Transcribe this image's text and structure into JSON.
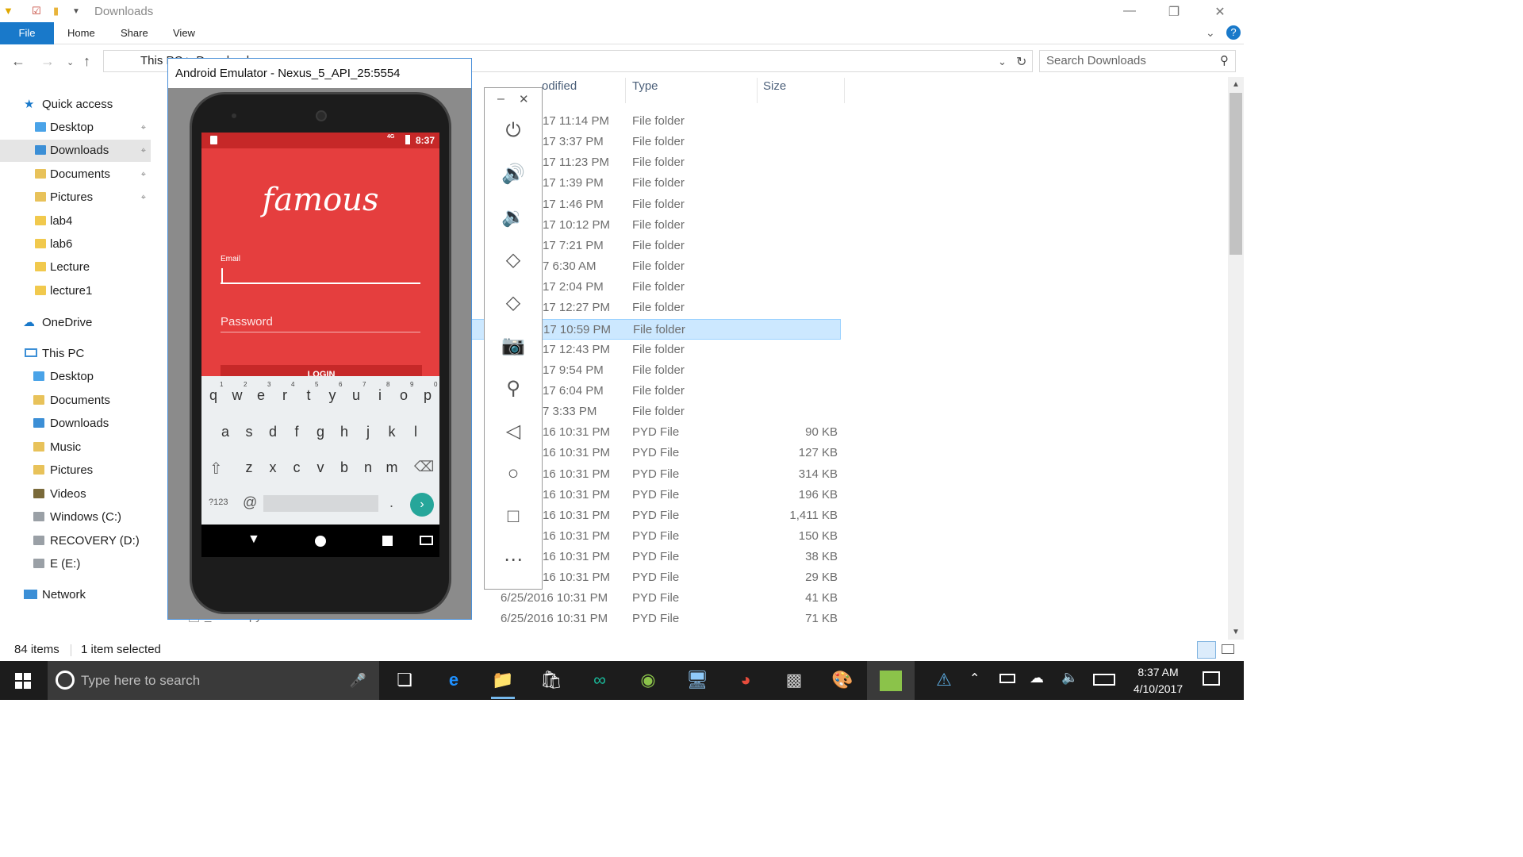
{
  "window": {
    "title": "Downloads",
    "tabs": [
      "File",
      "Home",
      "Share",
      "View"
    ]
  },
  "address": {
    "path": "This PC > Downloads",
    "search_placeholder": "Search Downloads"
  },
  "nav": {
    "quick_access": "Quick access",
    "quick_items": [
      {
        "label": "Desktop",
        "pinned": true,
        "icon": "folder-blue-icon"
      },
      {
        "label": "Downloads",
        "pinned": true,
        "icon": "downloads-icon",
        "selected": true
      },
      {
        "label": "Documents",
        "pinned": true,
        "icon": "documents-icon"
      },
      {
        "label": "Pictures",
        "pinned": true,
        "icon": "pictures-icon"
      },
      {
        "label": "lab4",
        "pinned": false,
        "icon": "folder-icon"
      },
      {
        "label": "lab6",
        "pinned": false,
        "icon": "folder-icon"
      },
      {
        "label": "Lecture",
        "pinned": false,
        "icon": "folder-icon"
      },
      {
        "label": "lecture1",
        "pinned": false,
        "icon": "folder-icon"
      }
    ],
    "onedrive": "OneDrive",
    "this_pc": "This PC",
    "pc_items": [
      {
        "label": "Desktop",
        "icon": "folder-blue-icon"
      },
      {
        "label": "Documents",
        "icon": "documents-icon"
      },
      {
        "label": "Downloads",
        "icon": "downloads-icon"
      },
      {
        "label": "Music",
        "icon": "music-icon"
      },
      {
        "label": "Pictures",
        "icon": "pictures-icon"
      },
      {
        "label": "Videos",
        "icon": "videos-icon"
      },
      {
        "label": "Windows (C:)",
        "icon": "drive-icon"
      },
      {
        "label": "RECOVERY (D:)",
        "icon": "drive-icon"
      },
      {
        "label": "E (E:)",
        "icon": "drive-icon"
      }
    ],
    "network": "Network"
  },
  "columns": {
    "modified": "odified",
    "type": "Type",
    "size": "Size"
  },
  "rows": [
    {
      "date": "17 11:14 PM",
      "type": "File folder",
      "size": ""
    },
    {
      "date": "17 3:37 PM",
      "type": "File folder",
      "size": ""
    },
    {
      "date": "17 11:23 PM",
      "type": "File folder",
      "size": ""
    },
    {
      "date": "17 1:39 PM",
      "type": "File folder",
      "size": ""
    },
    {
      "date": "17 1:46 PM",
      "type": "File folder",
      "size": ""
    },
    {
      "date": "17 10:12 PM",
      "type": "File folder",
      "size": ""
    },
    {
      "date": "17 7:21 PM",
      "type": "File folder",
      "size": ""
    },
    {
      "date": "7 6:30 AM",
      "type": "File folder",
      "size": ""
    },
    {
      "date": "17 2:04 PM",
      "type": "File folder",
      "size": ""
    },
    {
      "date": "17 12:27 PM",
      "type": "File folder",
      "size": ""
    },
    {
      "date": "17 10:59 PM",
      "type": "File folder",
      "size": "",
      "selected": true
    },
    {
      "date": "17 12:43 PM",
      "type": "File folder",
      "size": ""
    },
    {
      "date": "17 9:54 PM",
      "type": "File folder",
      "size": ""
    },
    {
      "date": "17 6:04 PM",
      "type": "File folder",
      "size": ""
    },
    {
      "date": "7 3:33 PM",
      "type": "File folder",
      "size": ""
    },
    {
      "date": "16 10:31 PM",
      "type": "PYD File",
      "size": "90 KB"
    },
    {
      "date": "16 10:31 PM",
      "type": "PYD File",
      "size": "127 KB"
    },
    {
      "date": "16 10:31 PM",
      "type": "PYD File",
      "size": "314 KB"
    },
    {
      "date": "16 10:31 PM",
      "type": "PYD File",
      "size": "196 KB"
    },
    {
      "date": "16 10:31 PM",
      "type": "PYD File",
      "size": "1,411 KB"
    },
    {
      "date": "16 10:31 PM",
      "type": "PYD File",
      "size": "150 KB"
    },
    {
      "date": "16 10:31 PM",
      "type": "PYD File",
      "size": "38 KB"
    },
    {
      "date": "16 10:31 PM",
      "type": "PYD File",
      "size": "29 KB"
    }
  ],
  "full_rows": [
    {
      "date": "6/25/2016 10:31 PM",
      "type": "PYD File",
      "size": "41 KB"
    },
    {
      "date": "6/25/2016 10:31 PM",
      "type": "PYD File",
      "size": "71 KB"
    }
  ],
  "partial_filename": "_socket.pyd",
  "status": {
    "items": "84 items",
    "selected": "1 item selected"
  },
  "emulator": {
    "title": "Android Emulator - Nexus_5_API_25:5554",
    "time": "8:37",
    "network": "4G",
    "logo": "famous",
    "email_label": "Email",
    "password_label": "Password",
    "login_label": "LOGIN",
    "key_row1": [
      "q",
      "w",
      "e",
      "r",
      "t",
      "y",
      "u",
      "i",
      "o",
      "p"
    ],
    "key_row1_nums": [
      "1",
      "2",
      "3",
      "4",
      "5",
      "6",
      "7",
      "8",
      "9",
      "0"
    ],
    "key_row2": [
      "a",
      "s",
      "d",
      "f",
      "g",
      "h",
      "j",
      "k",
      "l"
    ],
    "key_row3": [
      "z",
      "x",
      "c",
      "v",
      "b",
      "n",
      "m"
    ],
    "sym_key": "?123",
    "at_key": "@",
    "dot_key": "."
  },
  "toolbar": {
    "items": [
      "power-icon",
      "volume-up-icon",
      "volume-down-icon",
      "rotate-left-icon",
      "rotate-right-icon",
      "camera-icon",
      "zoom-icon",
      "back-icon",
      "home-icon",
      "overview-icon",
      "more-icon"
    ]
  },
  "taskbar": {
    "search_placeholder": "Type here to search",
    "time": "8:37 AM",
    "date": "4/10/2017"
  },
  "colors": {
    "accent": "#1979ca",
    "selection": "#cce8ff",
    "app_red": "#e53e3e"
  }
}
